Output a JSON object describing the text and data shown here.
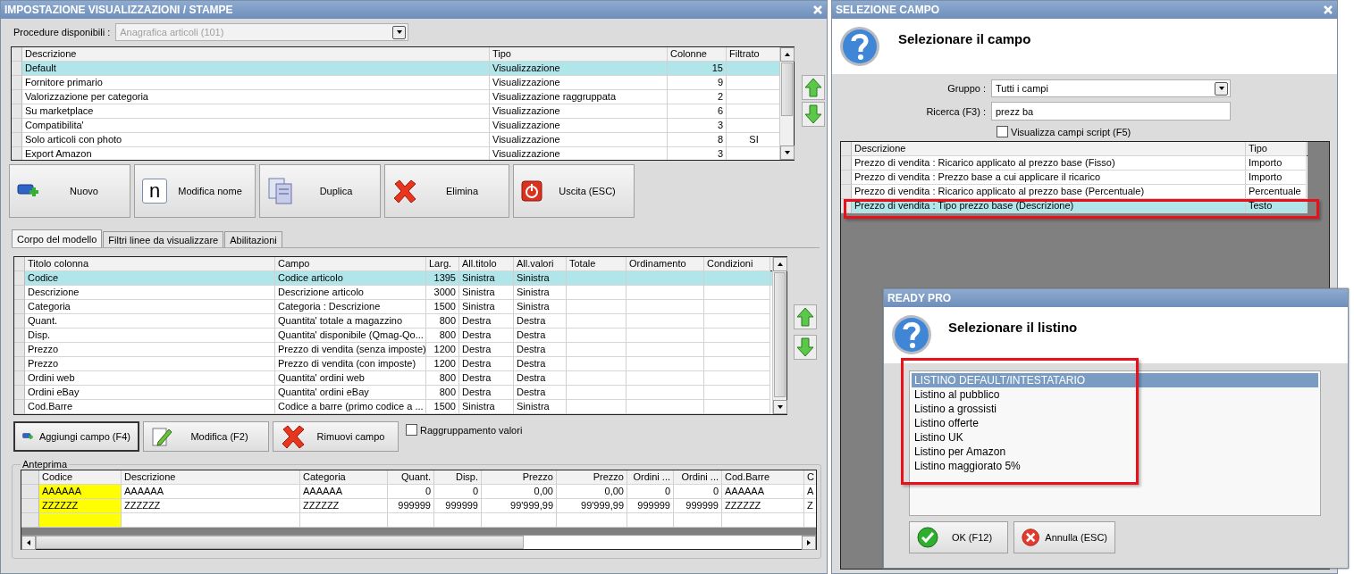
{
  "main_window": {
    "title": "IMPOSTAZIONE VISUALIZZAZIONI / STAMPE",
    "procedure": {
      "label": "Procedure disponibili :",
      "value": "Anagrafica articoli (101)",
      "disabled": true
    },
    "views_table": {
      "columns": [
        {
          "label": "Descrizione",
          "kind": "text"
        },
        {
          "label": "Tipo",
          "kind": "text"
        },
        {
          "label": "Colonne",
          "kind": "number"
        },
        {
          "label": "Filtrato",
          "kind": "flag"
        }
      ],
      "rows": [
        {
          "cells": [
            "Default",
            "Visualizzazione",
            "15"
          ],
          "selected": true
        },
        {
          "cells": [
            "Fornitore primario",
            "Visualizzazione",
            "9"
          ],
          "selected": false
        },
        {
          "cells": [
            "Valorizzazione per categoria",
            "Visualizzazione raggruppata",
            "2"
          ],
          "selected": false
        },
        {
          "cells": [
            "Su marketplace",
            "Visualizzazione",
            "6"
          ],
          "selected": false
        },
        {
          "cells": [
            "Compatibilita'",
            "Visualizzazione",
            "3"
          ],
          "selected": false
        },
        {
          "cells": [
            "Solo articoli con photo",
            "Visualizzazione",
            "8",
            "SI"
          ],
          "selected": false
        },
        {
          "cells": [
            "Export Amazon",
            "Visualizzazione",
            "3"
          ],
          "selected": false
        }
      ]
    },
    "actions": [
      {
        "kind": "new",
        "label": "Nuovo"
      },
      {
        "kind": "rename",
        "label": "Modifica nome",
        "icon_letter": "n"
      },
      {
        "kind": "duplicate",
        "label": "Duplica"
      },
      {
        "kind": "delete",
        "label": "Elimina"
      },
      {
        "kind": "exit",
        "label": "Uscita (ESC)"
      }
    ],
    "tabs": [
      {
        "label": "Corpo del modello",
        "selected": true
      },
      {
        "label": "Filtri linee da visualizzare",
        "selected": false
      },
      {
        "label": "Abilitazioni",
        "selected": false
      }
    ],
    "columns_table": {
      "columns": [
        {
          "label": "Titolo colonna",
          "kind": "text"
        },
        {
          "label": "Campo",
          "kind": "text"
        },
        {
          "label": "Larg.",
          "kind": "number"
        },
        {
          "label": "All.titolo",
          "kind": "text"
        },
        {
          "label": "All.valori",
          "kind": "text"
        },
        {
          "label": "Totale",
          "kind": "text"
        },
        {
          "label": "Ordinamento",
          "kind": "text"
        },
        {
          "label": "Condizioni",
          "kind": "text"
        }
      ],
      "rows": [
        {
          "cells": [
            "Codice",
            "Codice articolo",
            "1395",
            "Sinistra",
            "Sinistra"
          ],
          "selected": true
        },
        {
          "cells": [
            "Descrizione",
            "Descrizione articolo",
            "3000",
            "Sinistra",
            "Sinistra"
          ],
          "selected": false
        },
        {
          "cells": [
            "Categoria",
            "Categoria : Descrizione",
            "1500",
            "Sinistra",
            "Sinistra"
          ],
          "selected": false
        },
        {
          "cells": [
            "Quant.",
            "Quantita' totale a magazzino",
            "800",
            "Destra",
            "Destra"
          ],
          "selected": false
        },
        {
          "cells": [
            "Disp.",
            "Quantita' disponibile (Qmag-Qo...",
            "800",
            "Destra",
            "Destra"
          ],
          "selected": false
        },
        {
          "cells": [
            "Prezzo",
            "Prezzo di vendita (senza imposte)",
            "1200",
            "Destra",
            "Destra"
          ],
          "selected": false
        },
        {
          "cells": [
            "Prezzo",
            "Prezzo di vendita (con imposte)",
            "1200",
            "Destra",
            "Destra"
          ],
          "selected": false
        },
        {
          "cells": [
            "Ordini web",
            "Quantita' ordini web",
            "800",
            "Destra",
            "Destra"
          ],
          "selected": false
        },
        {
          "cells": [
            "Ordini eBay",
            "Quantita' ordini eBay",
            "800",
            "Destra",
            "Destra"
          ],
          "selected": false
        },
        {
          "cells": [
            "Cod.Barre",
            "Codice a barre (primo codice a ...",
            "1500",
            "Sinistra",
            "Sinistra"
          ],
          "selected": false
        }
      ]
    },
    "field_actions": [
      {
        "kind": "add",
        "label": "Aggiungi campo (F4)",
        "focused": true
      },
      {
        "kind": "edit",
        "label": "Modifica (F2)",
        "focused": false
      },
      {
        "kind": "remove",
        "label": "Rimuovi campo",
        "focused": false
      }
    ],
    "grouping": {
      "label": "Raggruppamento valori",
      "checked": false
    },
    "preview": {
      "title": "Anteprima",
      "columns": [
        {
          "label": "Codice",
          "kind": "text",
          "highlighted": true
        },
        {
          "label": "Descrizione",
          "kind": "text",
          "highlighted": false
        },
        {
          "label": "Categoria",
          "kind": "text",
          "highlighted": false
        },
        {
          "label": "Quant.",
          "kind": "number",
          "highlighted": false
        },
        {
          "label": "Disp.",
          "kind": "number",
          "highlighted": false
        },
        {
          "label": "Prezzo",
          "kind": "number",
          "highlighted": false
        },
        {
          "label": "Prezzo",
          "kind": "number",
          "highlighted": false
        },
        {
          "label": "Ordini ...",
          "kind": "number",
          "highlighted": false
        },
        {
          "label": "Ordini ...",
          "kind": "number",
          "highlighted": false
        },
        {
          "label": "Cod.Barre",
          "kind": "text",
          "highlighted": false
        },
        {
          "label": "C",
          "kind": "text",
          "highlighted": false
        }
      ],
      "rows": [
        {
          "cells": [
            "AAAAAA",
            "AAAAAA",
            "AAAAAA",
            "0",
            "0",
            "0,00",
            "0,00",
            "0",
            "0",
            "AAAAAA",
            "A"
          ]
        },
        {
          "cells": [
            "ZZZZZZ",
            "ZZZZZZ",
            "ZZZZZZ",
            "999999",
            "999999",
            "99'999,99",
            "99'999,99",
            "999999",
            "999999",
            "ZZZZZZ",
            "Z"
          ]
        }
      ]
    }
  },
  "field_window": {
    "title": "SELEZIONE CAMPO",
    "heading": "Selezionare il campo",
    "group": {
      "label": "Gruppo :",
      "value": "Tutti i campi"
    },
    "search": {
      "label": "Ricerca (F3) :",
      "value": "prezz ba"
    },
    "script_fields": {
      "label": "Visualizza campi script (F5)",
      "checked": false
    },
    "table": {
      "columns": [
        {
          "label": "Descrizione"
        },
        {
          "label": "Tipo"
        }
      ],
      "rows": [
        {
          "cells": [
            "Prezzo di vendita : Ricarico applicato al prezzo base (Fisso)",
            "Importo"
          ],
          "selected": false,
          "annotated": false
        },
        {
          "cells": [
            "Prezzo di vendita : Prezzo base a cui applicare il ricarico",
            "Importo"
          ],
          "selected": false,
          "annotated": false
        },
        {
          "cells": [
            "Prezzo di vendita : Ricarico applicato al prezzo base (Percentuale)",
            "Percentuale"
          ],
          "selected": false,
          "annotated": false
        },
        {
          "cells": [
            "Prezzo di vendita : Tipo prezzo base (Descrizione)",
            "Testo"
          ],
          "selected": true,
          "annotated": true
        }
      ]
    }
  },
  "dialog": {
    "title": "READY PRO",
    "heading": "Selezionare il listino",
    "annotated": true,
    "items": [
      {
        "label": "LISTINO DEFAULT/INTESTATARIO",
        "selected": true
      },
      {
        "label": "Listino al pubblico",
        "selected": false
      },
      {
        "label": "Listino a grossisti",
        "selected": false
      },
      {
        "label": "Listino offerte",
        "selected": false
      },
      {
        "label": "Listino UK",
        "selected": false
      },
      {
        "label": "Listino per Amazon",
        "selected": false
      },
      {
        "label": "Listino maggiorato 5%",
        "selected": false
      }
    ],
    "buttons": [
      {
        "kind": "ok",
        "label": "OK (F12)"
      },
      {
        "kind": "cancel",
        "label": "Annulla (ESC)"
      }
    ]
  }
}
